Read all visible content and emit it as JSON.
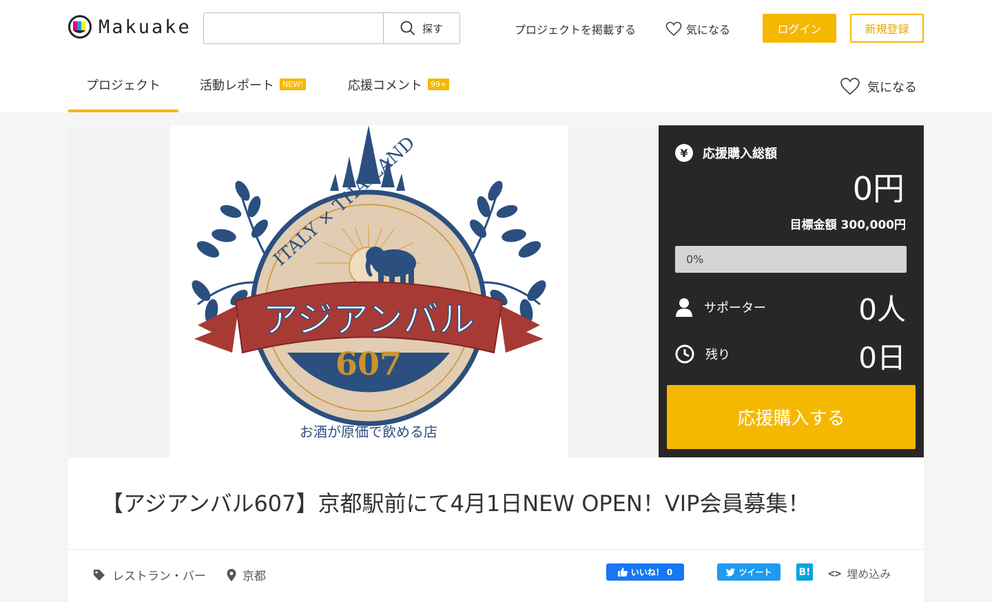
{
  "header": {
    "logo_text": "Makuake",
    "search": {
      "placeholder": "",
      "value": "",
      "button_label": "探す"
    },
    "post_project_label": "プロジェクトを掲載する",
    "favorite_label": "気になる",
    "login_label": "ログイン",
    "register_label": "新規登録"
  },
  "tabs": {
    "items": [
      {
        "label": "プロジェクト",
        "active": true,
        "badge": ""
      },
      {
        "label": "活動レポート",
        "active": false,
        "badge": "NEW!"
      },
      {
        "label": "応援コメント",
        "active": false,
        "badge": "99+"
      }
    ],
    "favorite_label": "気になる"
  },
  "project_image": {
    "ribbon_text": "アジアンバル",
    "number_text": "607",
    "arc_text": "ITALY × THAILAND",
    "bottom_text": "お酒が原価で飲める店",
    "colors": {
      "navy": "#2b4f7e",
      "ribbon": "#a83a36",
      "beige": "#e2ccb2",
      "gold": "#c9932e"
    }
  },
  "sidebar": {
    "total_label": "応援購入総額",
    "total_amount": "0円",
    "goal_text": "目標金額 300,000円",
    "progress_percent": 0,
    "progress_text": "0%",
    "supporters_label": "サポーター",
    "supporters_value": "0人",
    "remaining_label": "残り",
    "remaining_value": "0日",
    "buy_button_label": "応援購入する"
  },
  "project": {
    "title": "【アジアンバル607】京都駅前にて4月1日NEW OPEN！VIP会員募集！",
    "category": "レストラン・バー",
    "location": "京都"
  },
  "share": {
    "facebook_label": "いいね！ 0",
    "twitter_label": "ツイート",
    "hatena_label": "B!",
    "embed_label": "埋め込み"
  },
  "colors": {
    "accent": "#f5b800",
    "sidebar_bg": "#272727"
  }
}
